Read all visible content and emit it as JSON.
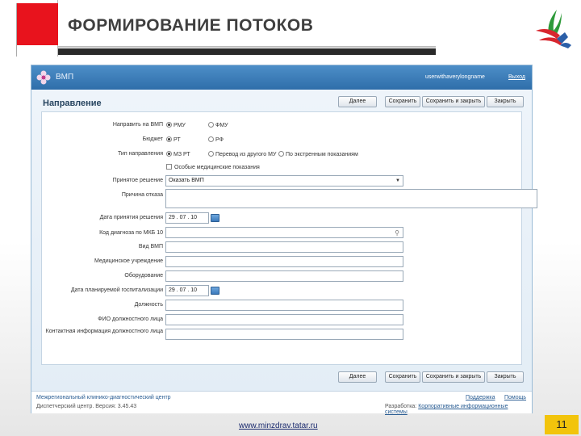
{
  "slide": {
    "title": "ФОРМИРОВАНИЕ ПОТОКОВ",
    "url": "www.minzdrav.tatar.ru",
    "page_number": "11",
    "accent_color": "#e8131d",
    "page_number_bg": "#f2c40c"
  },
  "app": {
    "brand": "ВМП",
    "user": "userwithaverylongname",
    "logout": "Выход",
    "heading": "Направление",
    "buttons": {
      "back": "Далее",
      "save": "Сохранить",
      "save_close": "Сохранить и закрыть",
      "close": "Закрыть"
    },
    "form": {
      "direction": {
        "label": "Направить на ВМП",
        "options": [
          {
            "label": "РМУ",
            "checked": true
          },
          {
            "label": "ФМУ",
            "checked": false
          }
        ]
      },
      "budget": {
        "label": "Бюджет",
        "options": [
          {
            "label": "РТ",
            "checked": true
          },
          {
            "label": "РФ",
            "checked": false
          }
        ]
      },
      "referral_type": {
        "label": "Тип направления",
        "options": [
          {
            "label": "МЗ РТ",
            "checked": true
          },
          {
            "label": "Перевод из другого МУ",
            "checked": false
          },
          {
            "label": "По экстренным показаниям",
            "checked": false
          }
        ]
      },
      "special": {
        "label": "Особые медицинские показания",
        "checked": false
      },
      "decision": {
        "label": "Принятое решение",
        "value": "Оказать ВМП"
      },
      "refusal_reason": {
        "label": "Причина отказа",
        "value": ""
      },
      "decision_date": {
        "label": "Дата принятия решения",
        "value": "29 . 07 . 10"
      },
      "mkb_code": {
        "label": "Код диагноза по МКБ 10",
        "value": ""
      },
      "vmp_type": {
        "label": "Вид ВМП",
        "value": ""
      },
      "institution": {
        "label": "Медицинское учреждение",
        "value": ""
      },
      "equipment": {
        "label": "Оборудование",
        "value": ""
      },
      "planned_date": {
        "label": "Дата планируемой госпитализации",
        "value": "29 . 07 . 10"
      },
      "position": {
        "label": "Должность",
        "value": ""
      },
      "official_name": {
        "label": "ФИО должностного лица",
        "value": ""
      },
      "official_contact": {
        "label": "Контактная информация должностного лица",
        "value": ""
      }
    },
    "footer": {
      "org": "Межрегиональный клинико-диагностический центр",
      "version": "Диспетчерский центр. Версия: 3.45.43",
      "support": "Поддержка",
      "help": "Помощь",
      "developer_label": "Разработка:",
      "developer": "Корпоративные информационные системы"
    },
    "colors": {
      "appbar": "#3a7ab8",
      "content_bg": "#e9f1f8",
      "link": "#2a5d93"
    }
  }
}
